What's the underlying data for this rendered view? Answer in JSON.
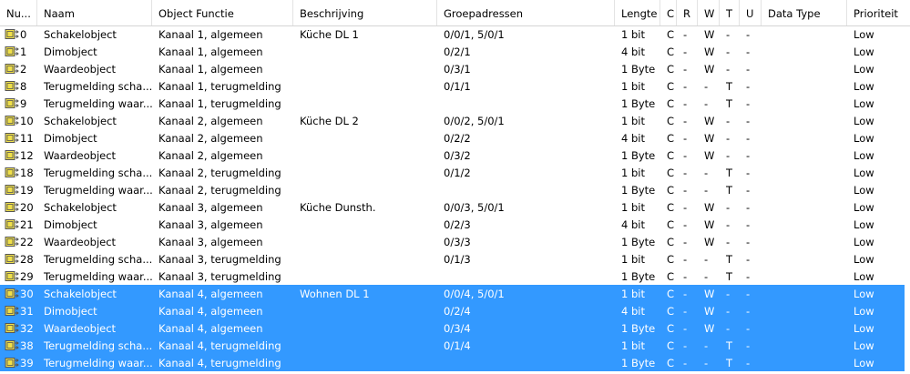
{
  "columns": [
    "Nu...",
    "Naam",
    "Object Functie",
    "Beschrijving",
    "Groepadressen",
    "Lengte",
    "C",
    "R",
    "W",
    "T",
    "U",
    "Data Type",
    "Prioriteit"
  ],
  "icon": "communication-object-icon",
  "colors": {
    "selection": "#3399ff",
    "icon_fill": "#f0e04a",
    "icon_outline": "#555555"
  },
  "rows": [
    {
      "nr": "0",
      "naam": "Schakelobject",
      "functie": "Kanaal 1, algemeen",
      "beschrijving": "Küche DL 1",
      "groep": "0/0/1, 5/0/1",
      "lengte": "1 bit",
      "c": "C",
      "r": "-",
      "w": "W",
      "t": "-",
      "u": "-",
      "dtype": "",
      "prio": "Low",
      "selected": false
    },
    {
      "nr": "1",
      "naam": "Dimobject",
      "functie": "Kanaal 1, algemeen",
      "beschrijving": "",
      "groep": "0/2/1",
      "lengte": "4 bit",
      "c": "C",
      "r": "-",
      "w": "W",
      "t": "-",
      "u": "-",
      "dtype": "",
      "prio": "Low",
      "selected": false
    },
    {
      "nr": "2",
      "naam": "Waardeobject",
      "functie": "Kanaal 1, algemeen",
      "beschrijving": "",
      "groep": "0/3/1",
      "lengte": "1 Byte",
      "c": "C",
      "r": "-",
      "w": "W",
      "t": "-",
      "u": "-",
      "dtype": "",
      "prio": "Low",
      "selected": false
    },
    {
      "nr": "8",
      "naam": "Terugmelding scha...",
      "functie": "Kanaal 1, terugmelding",
      "beschrijving": "",
      "groep": "0/1/1",
      "lengte": "1 bit",
      "c": "C",
      "r": "-",
      "w": "-",
      "t": "T",
      "u": "-",
      "dtype": "",
      "prio": "Low",
      "selected": false
    },
    {
      "nr": "9",
      "naam": "Terugmelding waar...",
      "functie": "Kanaal 1, terugmelding",
      "beschrijving": "",
      "groep": "",
      "lengte": "1 Byte",
      "c": "C",
      "r": "-",
      "w": "-",
      "t": "T",
      "u": "-",
      "dtype": "",
      "prio": "Low",
      "selected": false
    },
    {
      "nr": "10",
      "naam": "Schakelobject",
      "functie": "Kanaal 2, algemeen",
      "beschrijving": "Küche DL 2",
      "groep": "0/0/2, 5/0/1",
      "lengte": "1 bit",
      "c": "C",
      "r": "-",
      "w": "W",
      "t": "-",
      "u": "-",
      "dtype": "",
      "prio": "Low",
      "selected": false
    },
    {
      "nr": "11",
      "naam": "Dimobject",
      "functie": "Kanaal 2, algemeen",
      "beschrijving": "",
      "groep": "0/2/2",
      "lengte": "4 bit",
      "c": "C",
      "r": "-",
      "w": "W",
      "t": "-",
      "u": "-",
      "dtype": "",
      "prio": "Low",
      "selected": false
    },
    {
      "nr": "12",
      "naam": "Waardeobject",
      "functie": "Kanaal 2, algemeen",
      "beschrijving": "",
      "groep": "0/3/2",
      "lengte": "1 Byte",
      "c": "C",
      "r": "-",
      "w": "W",
      "t": "-",
      "u": "-",
      "dtype": "",
      "prio": "Low",
      "selected": false
    },
    {
      "nr": "18",
      "naam": "Terugmelding scha...",
      "functie": "Kanaal 2, terugmelding",
      "beschrijving": "",
      "groep": "0/1/2",
      "lengte": "1 bit",
      "c": "C",
      "r": "-",
      "w": "-",
      "t": "T",
      "u": "-",
      "dtype": "",
      "prio": "Low",
      "selected": false
    },
    {
      "nr": "19",
      "naam": "Terugmelding waar...",
      "functie": "Kanaal 2, terugmelding",
      "beschrijving": "",
      "groep": "",
      "lengte": "1 Byte",
      "c": "C",
      "r": "-",
      "w": "-",
      "t": "T",
      "u": "-",
      "dtype": "",
      "prio": "Low",
      "selected": false
    },
    {
      "nr": "20",
      "naam": "Schakelobject",
      "functie": "Kanaal 3, algemeen",
      "beschrijving": "Küche Dunsth.",
      "groep": "0/0/3, 5/0/1",
      "lengte": "1 bit",
      "c": "C",
      "r": "-",
      "w": "W",
      "t": "-",
      "u": "-",
      "dtype": "",
      "prio": "Low",
      "selected": false
    },
    {
      "nr": "21",
      "naam": "Dimobject",
      "functie": "Kanaal 3, algemeen",
      "beschrijving": "",
      "groep": "0/2/3",
      "lengte": "4 bit",
      "c": "C",
      "r": "-",
      "w": "W",
      "t": "-",
      "u": "-",
      "dtype": "",
      "prio": "Low",
      "selected": false
    },
    {
      "nr": "22",
      "naam": "Waardeobject",
      "functie": "Kanaal 3, algemeen",
      "beschrijving": "",
      "groep": "0/3/3",
      "lengte": "1 Byte",
      "c": "C",
      "r": "-",
      "w": "W",
      "t": "-",
      "u": "-",
      "dtype": "",
      "prio": "Low",
      "selected": false
    },
    {
      "nr": "28",
      "naam": "Terugmelding scha...",
      "functie": "Kanaal 3, terugmelding",
      "beschrijving": "",
      "groep": "0/1/3",
      "lengte": "1 bit",
      "c": "C",
      "r": "-",
      "w": "-",
      "t": "T",
      "u": "-",
      "dtype": "",
      "prio": "Low",
      "selected": false
    },
    {
      "nr": "29",
      "naam": "Terugmelding waar...",
      "functie": "Kanaal 3, terugmelding",
      "beschrijving": "",
      "groep": "",
      "lengte": "1 Byte",
      "c": "C",
      "r": "-",
      "w": "-",
      "t": "T",
      "u": "-",
      "dtype": "",
      "prio": "Low",
      "selected": false
    },
    {
      "nr": "30",
      "naam": "Schakelobject",
      "functie": "Kanaal 4, algemeen",
      "beschrijving": "Wohnen DL 1",
      "groep": "0/0/4, 5/0/1",
      "lengte": "1 bit",
      "c": "C",
      "r": "-",
      "w": "W",
      "t": "-",
      "u": "-",
      "dtype": "",
      "prio": "Low",
      "selected": true
    },
    {
      "nr": "31",
      "naam": "Dimobject",
      "functie": "Kanaal 4, algemeen",
      "beschrijving": "",
      "groep": "0/2/4",
      "lengte": "4 bit",
      "c": "C",
      "r": "-",
      "w": "W",
      "t": "-",
      "u": "-",
      "dtype": "",
      "prio": "Low",
      "selected": true
    },
    {
      "nr": "32",
      "naam": "Waardeobject",
      "functie": "Kanaal 4, algemeen",
      "beschrijving": "",
      "groep": "0/3/4",
      "lengte": "1 Byte",
      "c": "C",
      "r": "-",
      "w": "W",
      "t": "-",
      "u": "-",
      "dtype": "",
      "prio": "Low",
      "selected": true
    },
    {
      "nr": "38",
      "naam": "Terugmelding scha...",
      "functie": "Kanaal 4, terugmelding",
      "beschrijving": "",
      "groep": "0/1/4",
      "lengte": "1 bit",
      "c": "C",
      "r": "-",
      "w": "-",
      "t": "T",
      "u": "-",
      "dtype": "",
      "prio": "Low",
      "selected": true
    },
    {
      "nr": "39",
      "naam": "Terugmelding waar...",
      "functie": "Kanaal 4, terugmelding",
      "beschrijving": "",
      "groep": "",
      "lengte": "1 Byte",
      "c": "C",
      "r": "-",
      "w": "-",
      "t": "T",
      "u": "-",
      "dtype": "",
      "prio": "Low",
      "selected": true
    }
  ]
}
